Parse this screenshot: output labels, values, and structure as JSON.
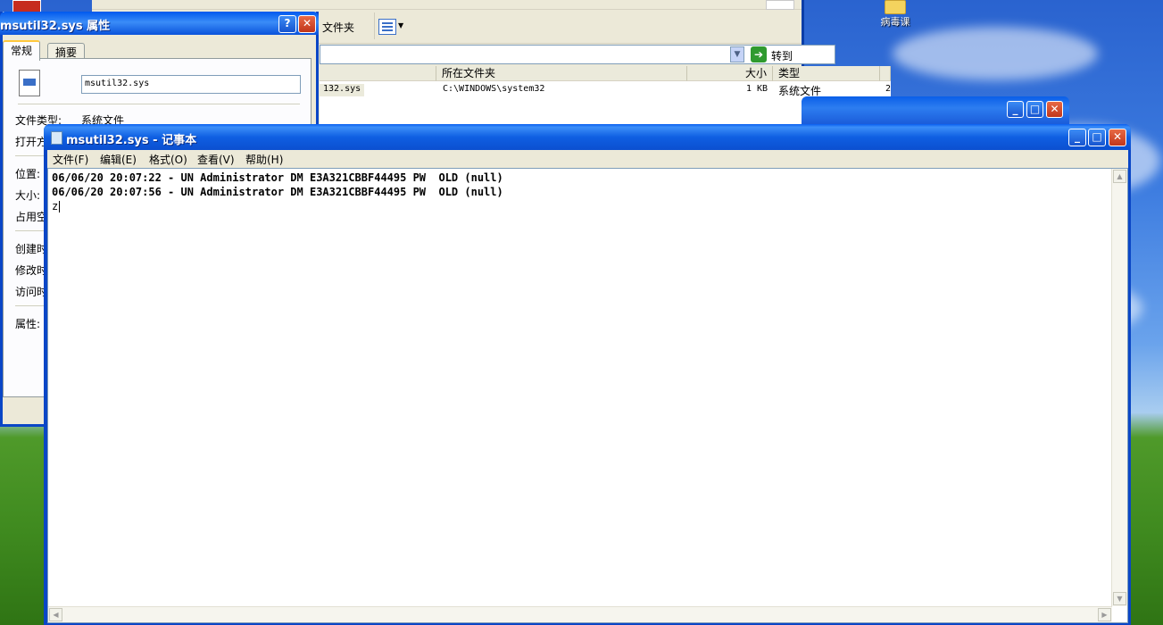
{
  "desktop": {
    "folder_label": "病毒课"
  },
  "explorer": {
    "folder_button": "文件夹",
    "goto_label": "转到",
    "columns": [
      "所在文件夹",
      "大小",
      "类型"
    ],
    "row": {
      "name": "132.sys",
      "folder": "C:\\WINDOWS\\system32",
      "size": "1 KB",
      "type": "系统文件",
      "extra": "2"
    }
  },
  "properties": {
    "title": "msutil32.sys 属性",
    "tabs": [
      "常规",
      "摘要"
    ],
    "filename": "msutil32.sys",
    "labels": {
      "file_type": "文件类型:",
      "file_type_value": "系统文件",
      "opens_with": "打开方",
      "location": "位置:",
      "size": "大小:",
      "size_on_disk": "占用空",
      "created": "创建时",
      "modified": "修改时",
      "accessed": "访问时",
      "attributes": "属性:"
    }
  },
  "notepad": {
    "title": "msutil32.sys - 记事本",
    "menus": [
      "文件(F)",
      "编辑(E)",
      "格式(O)",
      "查看(V)",
      "帮助(H)"
    ],
    "lines": [
      "06/06/20 20:07:22 - UN Administrator DM E3A321CBBF44495 PW  OLD (null)",
      "06/06/20 20:07:56 - UN Administrator DM E3A321CBBF44495 PW  OLD (null)",
      "z"
    ]
  },
  "colors": {
    "xp_title_blue": "#0a5fe8",
    "close_red": "#c1361a",
    "dialog_bg": "#ece9d8"
  }
}
